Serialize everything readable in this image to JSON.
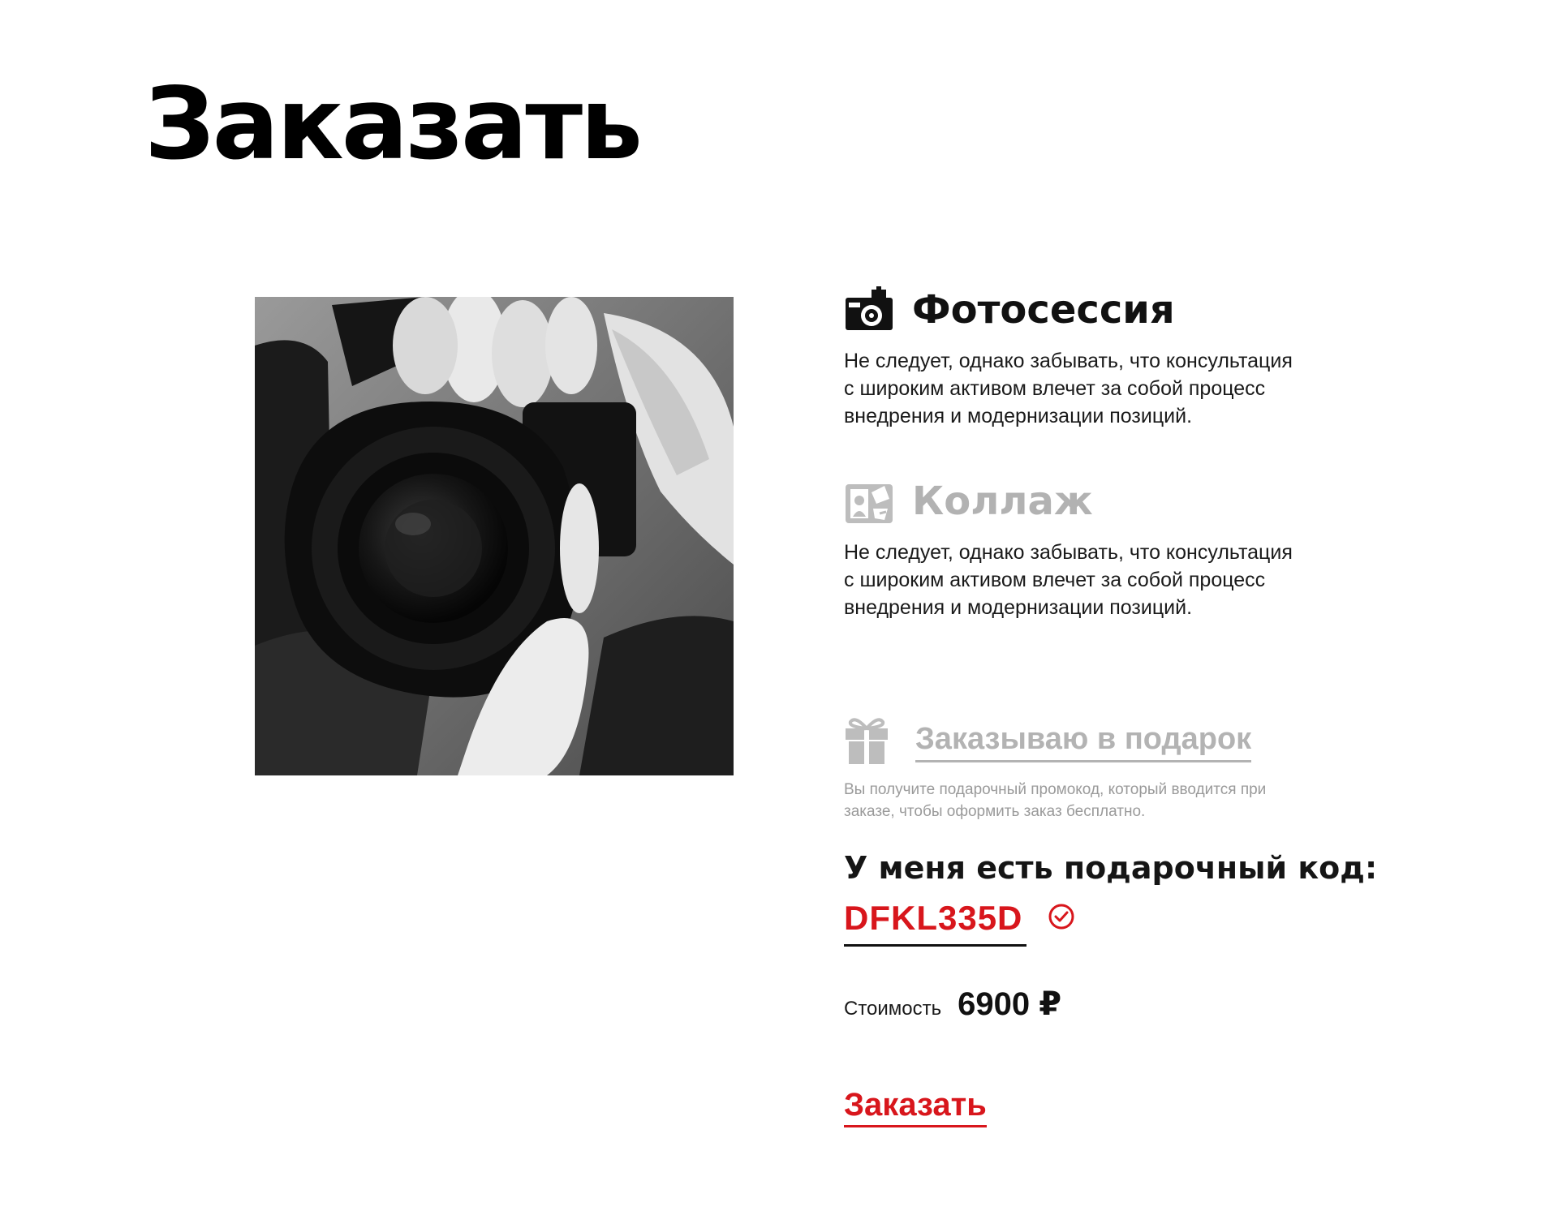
{
  "page": {
    "title": "Заказать"
  },
  "options": [
    {
      "title": "Фотосессия",
      "icon": "camera-icon",
      "state": "selected",
      "description": "Не следует, однако забывать, что консультация с широким активом влечет за собой процесс внедрения и модернизации позиций."
    },
    {
      "title": "Коллаж",
      "icon": "collage-icon",
      "state": "unselected",
      "description": "Не следует, однако забывать, что консультация с широким активом влечет за собой процесс внедрения и модернизации позиций."
    }
  ],
  "gift": {
    "label": "Заказываю в подарок",
    "icon": "gift-icon",
    "note": "Вы получите подарочный промокод, который вводится при заказе, чтобы оформить заказ бесплатно."
  },
  "promo": {
    "title": "У меня есть подарочный код:",
    "code": "DFKL335D",
    "status": "valid"
  },
  "price": {
    "label": "Стоимость",
    "value": "6900 ₽"
  },
  "order_button": {
    "label": "Заказать"
  },
  "colors": {
    "accent": "#d8161c",
    "inactive": "#b3b3b3",
    "text": "#111111"
  }
}
